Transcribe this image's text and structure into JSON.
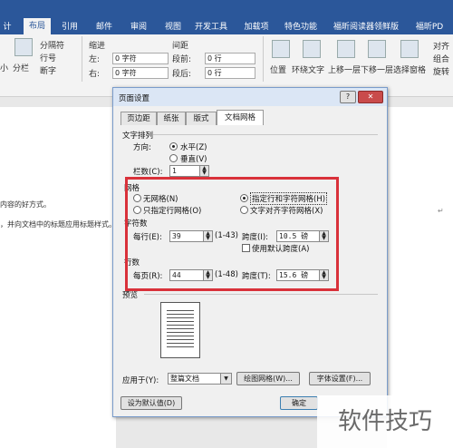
{
  "ribbon": {
    "tabs": [
      "计",
      "布局",
      "引用",
      "邮件",
      "审阅",
      "视图",
      "开发工具",
      "加载项",
      "特色功能",
      "福昕阅读器领鲜版",
      "福昕PD"
    ],
    "active_tab": "布局",
    "breaks": "分隔符",
    "line_numbers": "行号",
    "hyphen": "断字",
    "size_small": "小",
    "columns": "分栏",
    "indent_header": "缩进",
    "spacing_header": "间距",
    "left_label": "左:",
    "left_value": "0 字符",
    "right_label": "右:",
    "right_value": "0 字符",
    "before_label": "段前:",
    "before_value": "0 行",
    "after_label": "段后:",
    "after_value": "0 行",
    "position": "位置",
    "wrap_text": "环绕文字",
    "bring_forward": "上移一层",
    "send_backward": "下移一层",
    "selection_pane": "选择窗格",
    "align": "对齐",
    "group": "组合",
    "rotate": "旋转"
  },
  "document": {
    "line1": "内容的好方式。",
    "line2": "，并向文档中的标题应用标题样式。"
  },
  "dialog": {
    "title": "页面设置",
    "help": "?",
    "close": "✕",
    "tabs": [
      "页边距",
      "纸张",
      "版式",
      "文档网格"
    ],
    "active_tab": "文档网格",
    "text_direction_header": "文字排列",
    "direction_label": "方向:",
    "horizontal": "水平(Z)",
    "vertical": "垂直(V)",
    "columns_label": "栏数(C):",
    "columns_value": "1",
    "grid_header": "网格",
    "no_grid": "无网格(N)",
    "lines_only": "只指定行网格(O)",
    "lines_and_chars": "指定行和字符网格(H)",
    "snap_to_chars": "文字对齐字符网格(X)",
    "chars_header": "字符数",
    "per_line_label": "每行(E):",
    "per_line_value": "39",
    "per_line_range": "(1-43)",
    "char_pitch_label": "跨度(I):",
    "char_pitch_value": "10.5 磅",
    "default_pitch": "使用默认跨度(A)",
    "lines_header": "行数",
    "per_page_label": "每页(R):",
    "per_page_value": "44",
    "per_page_range": "(1-48)",
    "line_pitch_label": "跨度(T):",
    "line_pitch_value": "15.6 磅",
    "preview_header": "预览",
    "apply_label": "应用于(Y):",
    "apply_value": "整篇文档",
    "draw_grid": "绘图网格(W)...",
    "font_settings": "字体设置(F)...",
    "set_default": "设为默认值(D)",
    "ok": "确定"
  },
  "watermark": "软件技巧",
  "colors": {
    "accent": "#2b579a",
    "highlight": "#d9313a"
  }
}
